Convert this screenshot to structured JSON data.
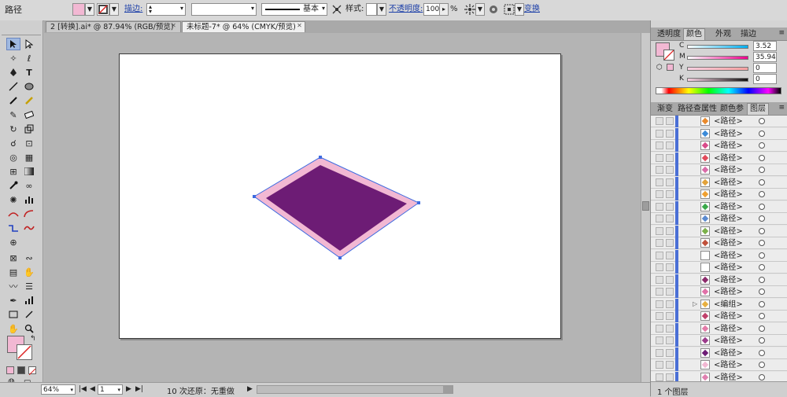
{
  "control_bar": {
    "selection_type": "路径",
    "stroke_label": "描边:",
    "stroke_profile": "基本",
    "style_label": "样式:",
    "opacity_label": "不透明度:",
    "opacity_value": "100",
    "opacity_unit": "%",
    "transform_link": "变换",
    "fill_color": "#f2b8d3"
  },
  "doc_tabs": [
    {
      "title": "2 [转换].ai* @ 87.94% (RGB/预览)",
      "active": false
    },
    {
      "title": "未标题-7* @ 64% (CMYK/预览)",
      "active": true
    }
  ],
  "canvas": {
    "shape_outer_color": "#f2b8d3",
    "shape_inner_color": "#6d1c75",
    "selection_color": "#3d6be0"
  },
  "status_bar": {
    "zoom": "64%",
    "page": "1",
    "undo_status": "10 次还原：无重做"
  },
  "color_panel": {
    "tabs": [
      "透明度",
      "颜色",
      "外观",
      "描边"
    ],
    "active_tab": "颜色",
    "channels": [
      {
        "label": "C",
        "value": "3.52"
      },
      {
        "label": "M",
        "value": "35.94"
      },
      {
        "label": "Y",
        "value": "0"
      },
      {
        "label": "K",
        "value": "0"
      }
    ],
    "fill_color": "#f2b8d3"
  },
  "layers_panel": {
    "tabs": [
      "渐变",
      "路径查",
      "属性",
      "颜色参",
      "图层"
    ],
    "active_tab": "图层",
    "items": [
      {
        "name": "<路径>",
        "thumb": "#e9892b"
      },
      {
        "name": "<路径>",
        "thumb": "#3a8ad8"
      },
      {
        "name": "<路径>",
        "thumb": "#d94b8a"
      },
      {
        "name": "<路径>",
        "thumb": "#e24a5b"
      },
      {
        "name": "<路径>",
        "thumb": "#d96aa8"
      },
      {
        "name": "<路径>",
        "thumb": "#e2a23a"
      },
      {
        "name": "<路径>",
        "thumb": "#f0a030"
      },
      {
        "name": "<路径>",
        "thumb": "#3aa94a"
      },
      {
        "name": "<路径>",
        "thumb": "#5a8ad0"
      },
      {
        "name": "<路径>",
        "thumb": "#7ab04a"
      },
      {
        "name": "<路径>",
        "thumb": "#c0503a"
      },
      {
        "name": "<路径>",
        "thumb": "#ffffff"
      },
      {
        "name": "<路径>",
        "thumb": "#ffffff"
      },
      {
        "name": "<路径>",
        "thumb": "#8b2a6a"
      },
      {
        "name": "<路径>",
        "thumb": "#e070a8"
      },
      {
        "name": "<编组>",
        "thumb": "#e8b040"
      },
      {
        "name": "<路径>",
        "thumb": "#c0406a"
      },
      {
        "name": "<路径>",
        "thumb": "#e47aa8"
      },
      {
        "name": "<路径>",
        "thumb": "#9a3a8a"
      },
      {
        "name": "<路径>",
        "thumb": "#6d1c75"
      },
      {
        "name": "<路径>",
        "thumb": "#f2b8d3"
      },
      {
        "name": "<路径>",
        "thumb": "#e080b0"
      }
    ],
    "footer": "1 个图层"
  }
}
